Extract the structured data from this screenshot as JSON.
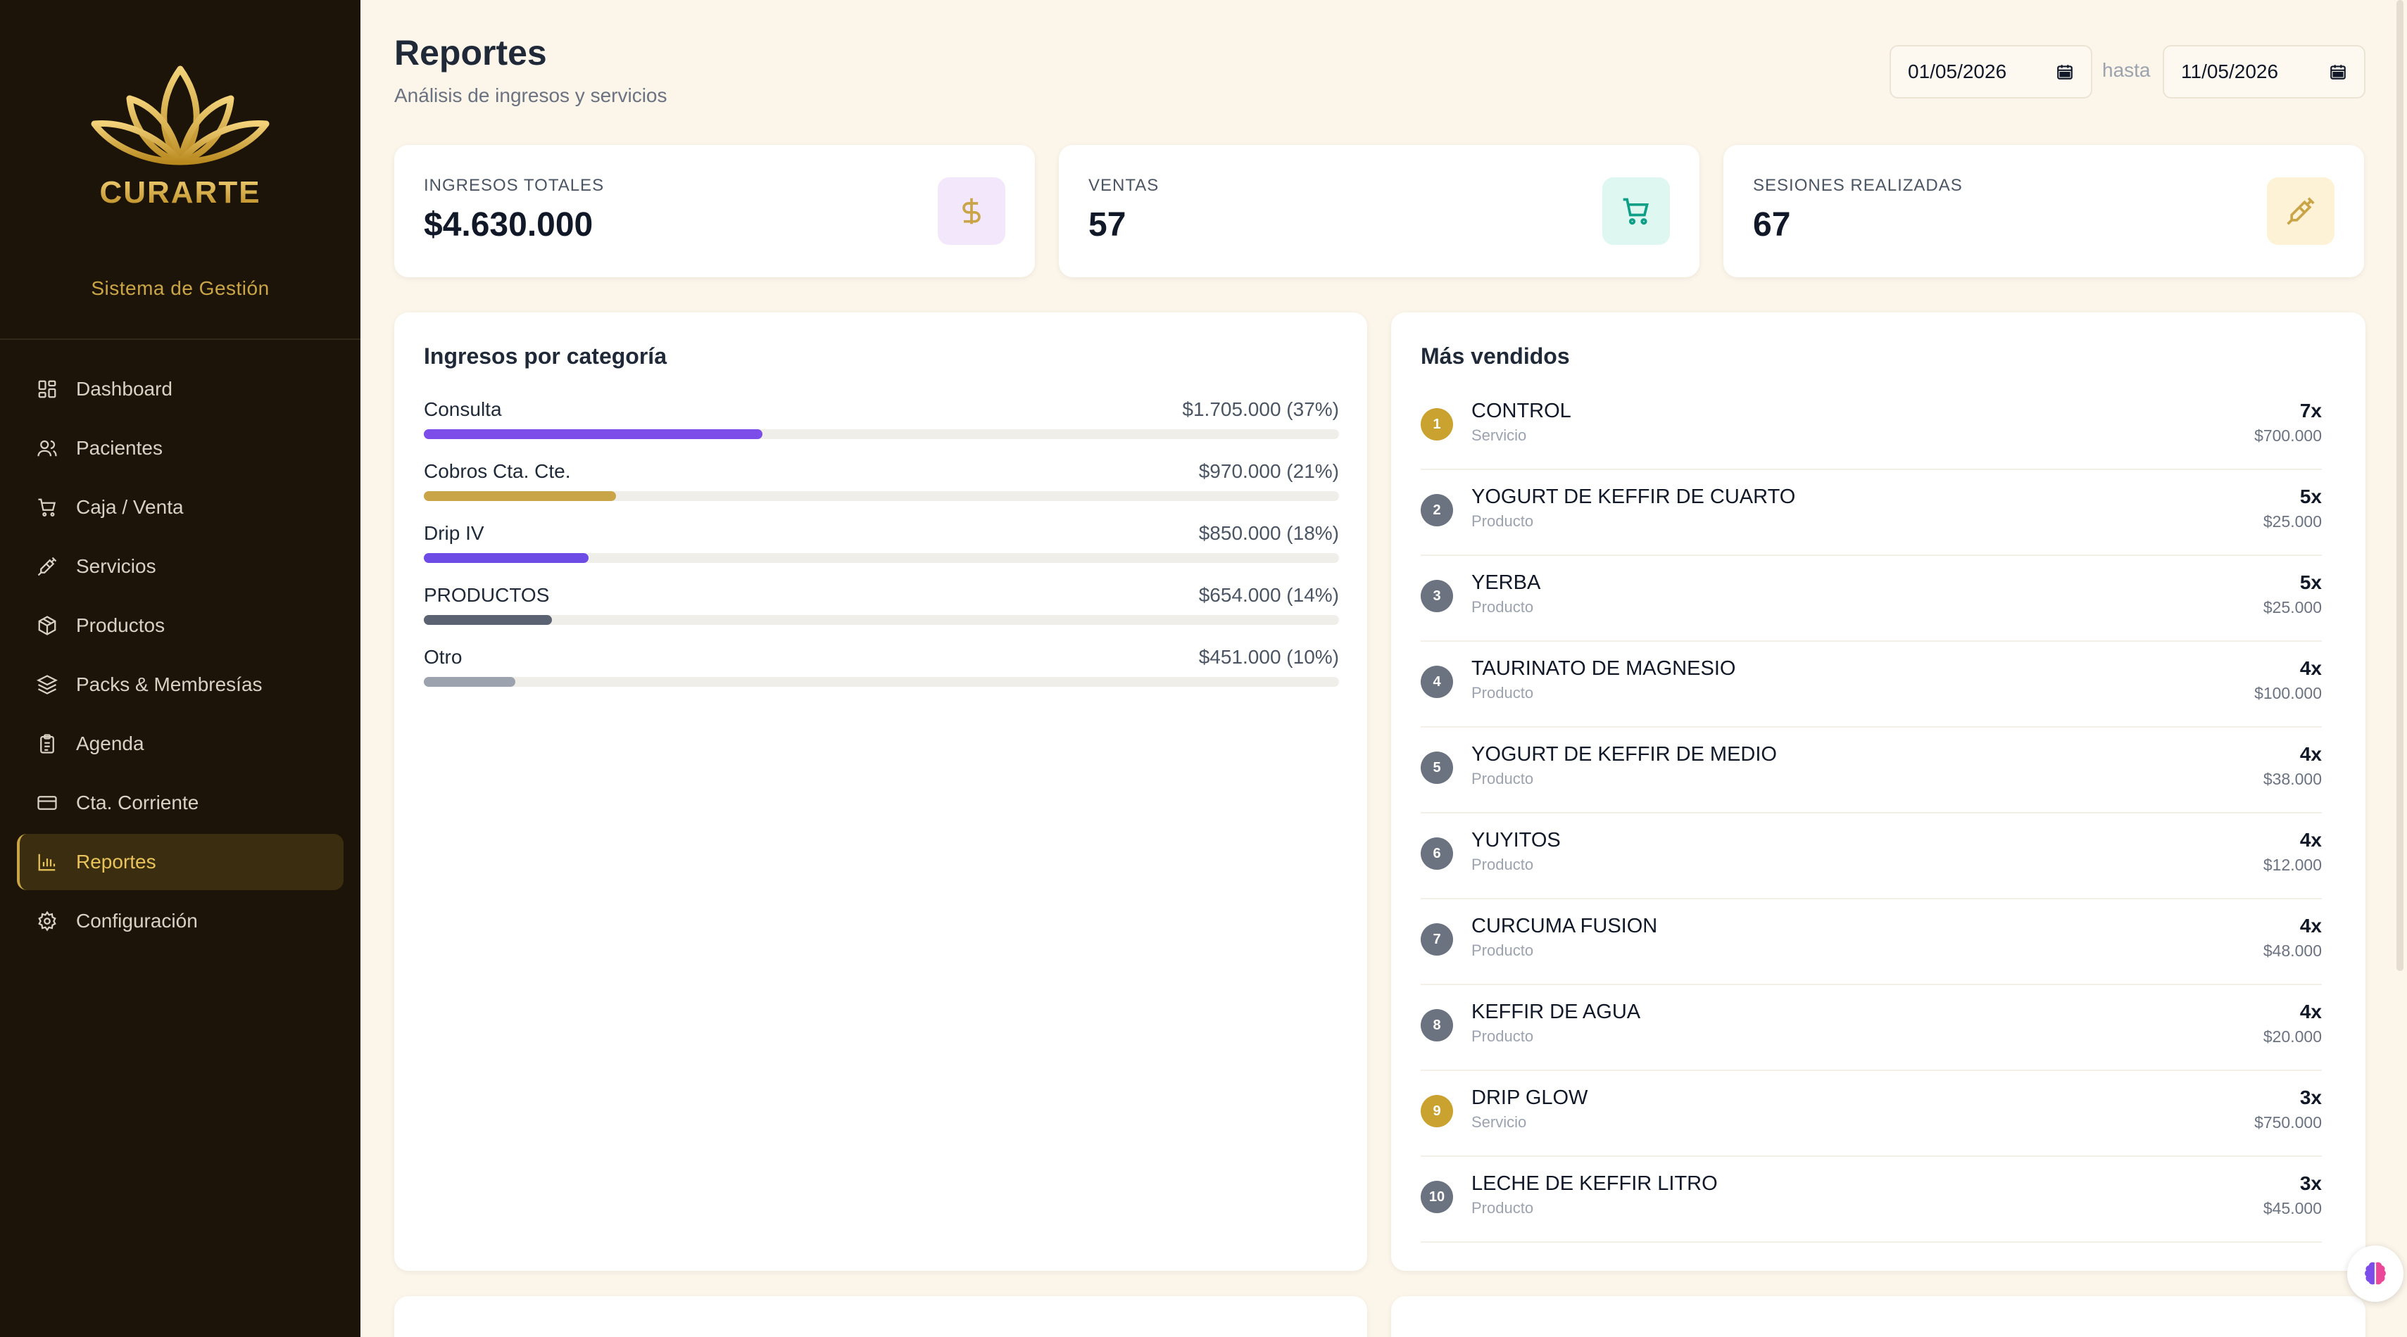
{
  "brand": {
    "name": "CURARTE",
    "subtitle": "Sistema de Gestión",
    "gold": "#c9a548"
  },
  "sidebar": {
    "items": [
      {
        "label": "Dashboard",
        "icon": "dashboard-icon"
      },
      {
        "label": "Pacientes",
        "icon": "users-icon"
      },
      {
        "label": "Caja / Venta",
        "icon": "cart-icon"
      },
      {
        "label": "Servicios",
        "icon": "syringe-icon"
      },
      {
        "label": "Productos",
        "icon": "package-icon"
      },
      {
        "label": "Packs & Membresías",
        "icon": "layers-icon"
      },
      {
        "label": "Agenda",
        "icon": "clipboard-icon"
      },
      {
        "label": "Cta. Corriente",
        "icon": "credit-card-icon"
      },
      {
        "label": "Reportes",
        "icon": "bar-chart-icon",
        "active": true
      },
      {
        "label": "Configuración",
        "icon": "gear-icon"
      }
    ]
  },
  "header": {
    "title": "Reportes",
    "subtitle": "Análisis de ingresos y servicios",
    "date_from": "01/05/2026",
    "date_separator": "hasta",
    "date_to": "11/05/2026"
  },
  "stats": [
    {
      "label": "INGRESOS TOTALES",
      "value": "$4.630.000",
      "icon": "dollar-icon",
      "icon_bg": "#f3e8fb",
      "icon_color": "#c9a548"
    },
    {
      "label": "VENTAS",
      "value": "57",
      "icon": "cart-icon",
      "icon_bg": "#dff7f1",
      "icon_color": "#0f9f86"
    },
    {
      "label": "SESIONES REALIZADAS",
      "value": "67",
      "icon": "syringe-icon",
      "icon_bg": "#fdf1d6",
      "icon_color": "#c9a548"
    }
  ],
  "categories_panel": {
    "title": "Ingresos por categoría",
    "items": [
      {
        "name": "Consulta",
        "amount": "$1.705.000 (37%)",
        "percent": 37,
        "color": "#7c4de8"
      },
      {
        "name": "Cobros Cta. Cte.",
        "amount": "$970.000 (21%)",
        "percent": 21,
        "color": "#c9a548"
      },
      {
        "name": "Drip IV",
        "amount": "$850.000 (18%)",
        "percent": 18,
        "color": "#6d4ce6"
      },
      {
        "name": "PRODUCTOS",
        "amount": "$654.000 (14%)",
        "percent": 14,
        "color": "#5b6372"
      },
      {
        "name": "Otro",
        "amount": "$451.000 (10%)",
        "percent": 10,
        "color": "#9ca3af"
      }
    ]
  },
  "top_panel": {
    "title": "Más vendidos",
    "items": [
      {
        "rank": "1",
        "name": "CONTROL",
        "type": "Servicio",
        "qty": "7x",
        "amount": "$700.000",
        "badge_color": "#c9a230"
      },
      {
        "rank": "2",
        "name": "YOGURT DE KEFFIR DE CUARTO",
        "type": "Producto",
        "qty": "5x",
        "amount": "$25.000",
        "badge_color": "#6b7280"
      },
      {
        "rank": "3",
        "name": "YERBA",
        "type": "Producto",
        "qty": "5x",
        "amount": "$25.000",
        "badge_color": "#6b7280"
      },
      {
        "rank": "4",
        "name": "TAURINATO DE MAGNESIO",
        "type": "Producto",
        "qty": "4x",
        "amount": "$100.000",
        "badge_color": "#6b7280"
      },
      {
        "rank": "5",
        "name": "YOGURT DE KEFFIR DE MEDIO",
        "type": "Producto",
        "qty": "4x",
        "amount": "$38.000",
        "badge_color": "#6b7280"
      },
      {
        "rank": "6",
        "name": "YUYITOS",
        "type": "Producto",
        "qty": "4x",
        "amount": "$12.000",
        "badge_color": "#6b7280"
      },
      {
        "rank": "7",
        "name": "CURCUMA FUSION",
        "type": "Producto",
        "qty": "4x",
        "amount": "$48.000",
        "badge_color": "#6b7280"
      },
      {
        "rank": "8",
        "name": "KEFFIR DE AGUA",
        "type": "Producto",
        "qty": "4x",
        "amount": "$20.000",
        "badge_color": "#6b7280"
      },
      {
        "rank": "9",
        "name": "DRIP GLOW",
        "type": "Servicio",
        "qty": "3x",
        "amount": "$750.000",
        "badge_color": "#c9a230"
      },
      {
        "rank": "10",
        "name": "LECHE DE KEFFIR LITRO",
        "type": "Producto",
        "qty": "3x",
        "amount": "$45.000",
        "badge_color": "#6b7280"
      }
    ]
  },
  "fab": {
    "icon": "brain-icon"
  }
}
